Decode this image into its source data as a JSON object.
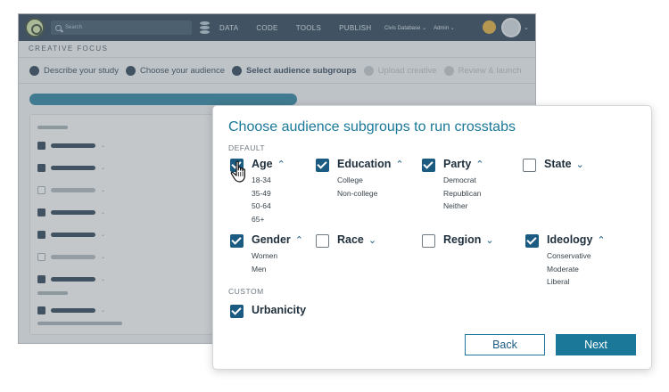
{
  "app": {
    "search_placeholder": "Search",
    "nav": [
      "DATA",
      "CODE",
      "TOOLS",
      "PUBLISH"
    ],
    "database_dropdown": "Civis Database",
    "admin_dropdown": "Admin",
    "section_title": "CREATIVE FOCUS",
    "steps": [
      {
        "label": "Describe your study",
        "active": true
      },
      {
        "label": "Choose your audience",
        "active": true
      },
      {
        "label": "Select audience subgroups",
        "active": true
      },
      {
        "label": "Upload creative",
        "active": false
      },
      {
        "label": "Review & launch",
        "active": false
      }
    ],
    "colors": {
      "topbar": "#1b3348",
      "accent": "#1b7898",
      "checkbox": "#1b5b82"
    }
  },
  "modal": {
    "title": "Choose audience subgroups to run crosstabs",
    "default_label": "DEFAULT",
    "custom_label": "CUSTOM",
    "groups": [
      {
        "name": "Age",
        "checked": true,
        "expanded": true,
        "options": [
          "18-34",
          "35-49",
          "50-64",
          "65+"
        ]
      },
      {
        "name": "Education",
        "checked": true,
        "expanded": true,
        "options": [
          "College",
          "Non-college"
        ]
      },
      {
        "name": "Party",
        "checked": true,
        "expanded": true,
        "options": [
          "Democrat",
          "Republican",
          "Neither"
        ]
      },
      {
        "name": "State",
        "checked": false,
        "expanded": false,
        "options": []
      },
      {
        "name": "Gender",
        "checked": true,
        "expanded": true,
        "options": [
          "Women",
          "Men"
        ]
      },
      {
        "name": "Race",
        "checked": false,
        "expanded": false,
        "options": []
      },
      {
        "name": "Region",
        "checked": false,
        "expanded": false,
        "options": []
      },
      {
        "name": "Ideology",
        "checked": true,
        "expanded": true,
        "options": [
          "Conservative",
          "Moderate",
          "Liberal"
        ]
      }
    ],
    "custom_groups": [
      {
        "name": "Urbanicity",
        "checked": true
      }
    ],
    "back_label": "Back",
    "next_label": "Next"
  }
}
